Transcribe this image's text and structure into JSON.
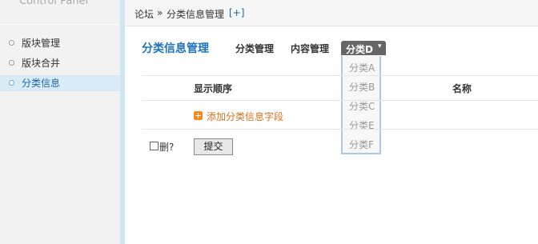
{
  "sidebar": {
    "brand": "Control Panel",
    "items": [
      {
        "label": "版块管理",
        "active": false
      },
      {
        "label": "版块合并",
        "active": false
      },
      {
        "label": "分类信息",
        "active": true
      }
    ]
  },
  "breadcrumb": {
    "root": "论坛",
    "separator": "»",
    "current": "分类信息管理",
    "add": "[+]"
  },
  "main": {
    "title": "分类信息管理",
    "nav": [
      "分类管理",
      "内容管理"
    ],
    "active_menu": {
      "label": "分类D",
      "arrow": "▾",
      "options": [
        "分类A",
        "分类B",
        "分类C",
        "分类E",
        "分类F"
      ]
    },
    "table": {
      "headers": [
        "显示顺序",
        "名称"
      ],
      "add_field_link": "添加分类信息字段"
    },
    "footer": {
      "delete_label": "删?",
      "submit_label": "提交"
    }
  },
  "colors": {
    "accent": "#1f72b8",
    "sidebar_bg": "#f2f2f2",
    "active_item_bg": "#d9ebf7",
    "add_link": "#d9711a",
    "dropdown_border": "#aac9e4"
  }
}
